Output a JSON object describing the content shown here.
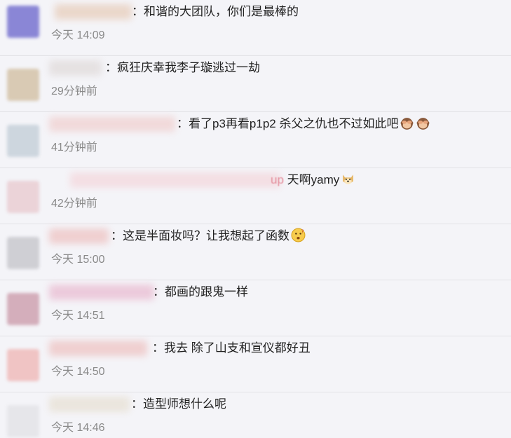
{
  "comments": [
    {
      "text": "：和谐的大团队，你们是最棒的",
      "time": "今天 14:09",
      "avatar_color": "#8a86d6",
      "name_color": "#e9d2c2"
    },
    {
      "text": "：疯狂庆幸我李子璇逃过一劫",
      "time": "29分钟前",
      "avatar_color": "#d9cab4",
      "name_color": "#e3dede"
    },
    {
      "text": "：看了p3再看p1p2 杀父之仇也不过如此吧",
      "time": "41分钟前",
      "avatar_color": "#cdd6de",
      "name_color": "#f1d5d5",
      "emoji_icons": [
        "monkey-see-no-evil-icon",
        "monkey-see-no-evil-icon"
      ]
    },
    {
      "name_tail": "up",
      "text": " 天啊yamy",
      "time": "42分钟前",
      "avatar_color": "#ebd3d8",
      "name_color": "#f4dbe0",
      "emoji_icons": [
        "doge-icon"
      ]
    },
    {
      "text": "：这是半面妆吗？让我想起了函数",
      "time": "今天 15:00",
      "avatar_color": "#cfcfd4",
      "name_color": "#efc9c9",
      "emoji_icons": [
        "thinking-face-icon"
      ]
    },
    {
      "text": "：都画的跟鬼一样",
      "time": "今天 14:51",
      "avatar_color": "#d4aebb",
      "name_color": "#ebc3d6"
    },
    {
      "text": "：我去 除了山支和宣仪都好丑",
      "time": "今天 14:50",
      "avatar_color": "#f0c4c4",
      "name_color": "#efc9c9"
    },
    {
      "text": "：造型师想什么呢",
      "time": "今天 14:46",
      "avatar_color": "#e6e6ea",
      "name_color": "#e9e3d8"
    }
  ]
}
